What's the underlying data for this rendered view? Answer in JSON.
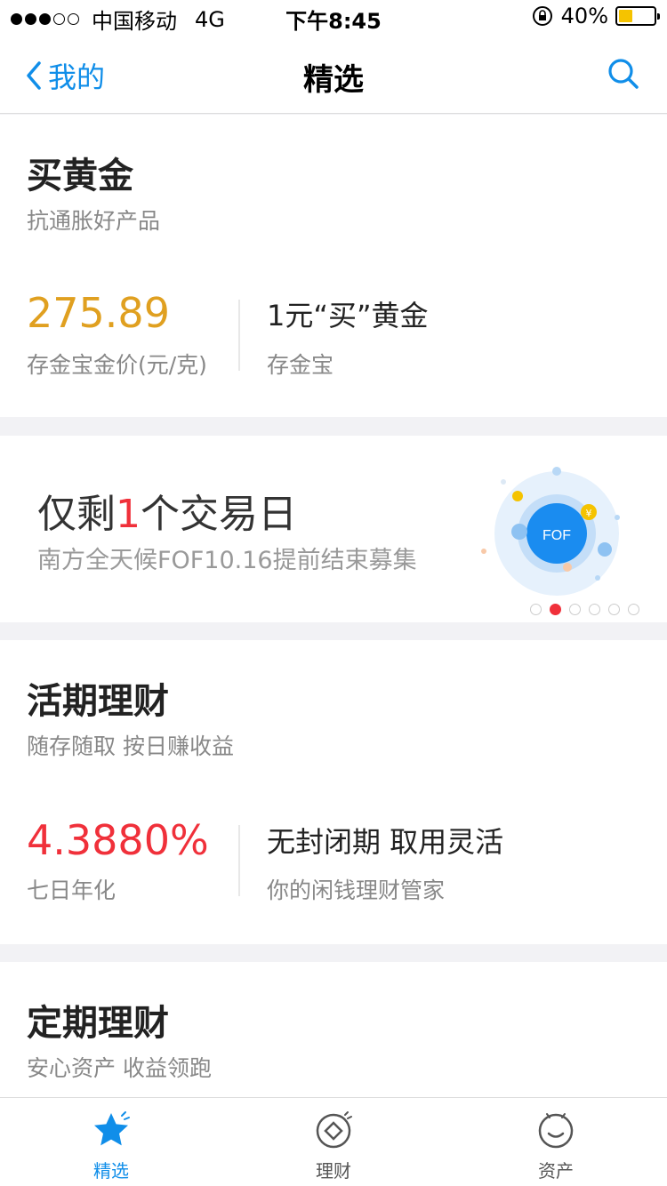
{
  "status_bar": {
    "carrier": "中国移动",
    "network": "4G",
    "time": "下午8:45",
    "battery_percent": "40%",
    "battery_level": 0.4
  },
  "nav": {
    "back_label": "我的",
    "title": "精选"
  },
  "gold": {
    "title": "买黄金",
    "subtitle": "抗通胀好产品",
    "price": "275.89",
    "price_label": "存金宝金价(元/克)",
    "feature_title": "1元“买”黄金",
    "feature_sub": "存金宝",
    "accent": "#e0a020"
  },
  "banner": {
    "title_before": "仅剩",
    "title_highlight": "1",
    "title_after": "个交易日",
    "subtitle": "南方全天候FOF10.16提前结束募集",
    "badge": "FOF",
    "pages": 6,
    "active_page": 1
  },
  "current": {
    "title": "活期理财",
    "subtitle": "随存随取 按日赚收益",
    "rate": "4.3880%",
    "rate_label": "七日年化",
    "feature_title": "无封闭期 取用灵活",
    "feature_sub": "你的闲钱理财管家",
    "accent": "#f0303a"
  },
  "fixed": {
    "title": "定期理财",
    "subtitle": "安心资产 收益领跑"
  },
  "tabs": [
    {
      "label": "精选",
      "icon": "star-icon",
      "active": true
    },
    {
      "label": "理财",
      "icon": "finance-icon",
      "active": false
    },
    {
      "label": "资产",
      "icon": "assets-icon",
      "active": false
    }
  ],
  "colors": {
    "primary": "#108ee9",
    "highlight": "#f0303a"
  }
}
